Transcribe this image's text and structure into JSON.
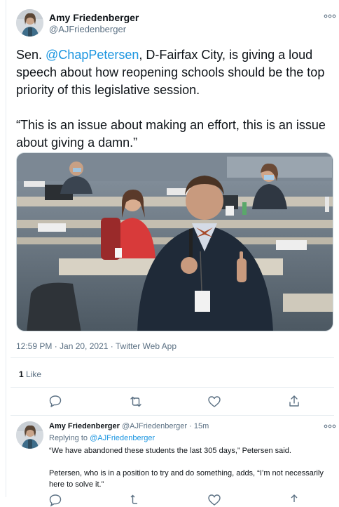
{
  "tweet": {
    "author_name": "Amy Friedenberger",
    "author_handle": "@AJFriedenberger",
    "text_before_mention": "Sen. ",
    "mention": "@ChapPetersen",
    "text_after_mention": ", D-Fairfax City, is giving a loud speech about how reopening schools should be the top priority of this legislative session.",
    "quote": "“This is an issue about making an effort, this is an issue about giving a damn.”",
    "timestamp": "12:59 PM · Jan 20, 2021 · Twitter Web App",
    "like_count": "1",
    "like_label": "Like"
  },
  "reply": {
    "author_name": "Amy Friedenberger",
    "author_handle": "@AJFriedenberger",
    "age": "· 15m",
    "replying_prefix": "Replying to ",
    "replying_to": "@AJFriedenberger",
    "paragraph_1": "“We have abandoned these students the last 305 days,” Petersen said.",
    "paragraph_2": "Petersen, who is in a position to try and do something, adds, “I’m not necessarily here to solve it.”"
  },
  "icons": {
    "more": "more-dots-icon",
    "reply": "reply-icon",
    "retweet": "retweet-icon",
    "like": "heart-icon",
    "share": "share-icon"
  },
  "colors": {
    "accent": "#1b95e0",
    "secondary_text": "#5b7083",
    "divider": "#e6ecf0"
  }
}
